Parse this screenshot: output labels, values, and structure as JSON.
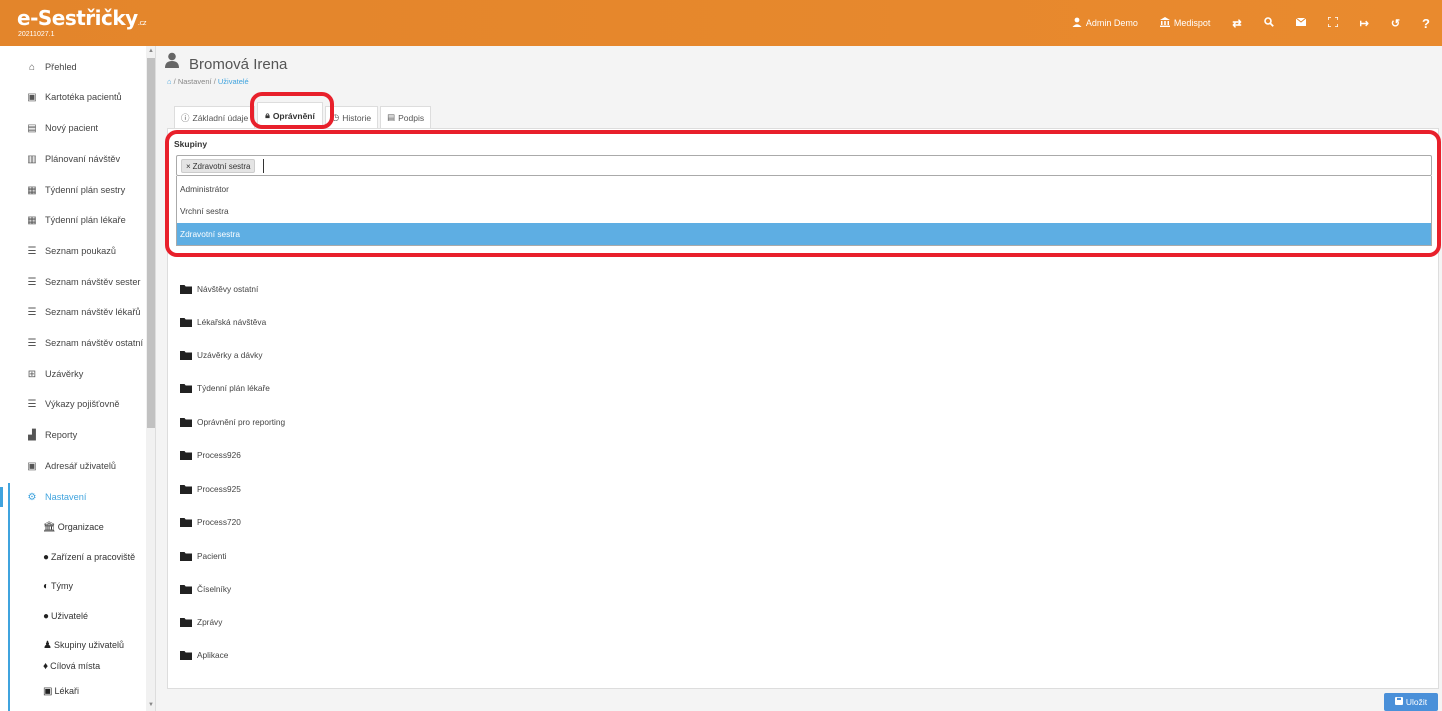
{
  "header": {
    "logo": "e-Sestřičky",
    "logo_suffix": ".cz",
    "version": "20211027.1",
    "nav": [
      {
        "label": "Admin Demo",
        "icon": "user-icon"
      },
      {
        "label": "Medispot",
        "icon": "institution-icon"
      },
      {
        "label": "",
        "icon": "switch-icon"
      },
      {
        "label": "",
        "icon": "search-icon"
      },
      {
        "label": "",
        "icon": "mail-icon"
      },
      {
        "label": "",
        "icon": "fullscreen-icon"
      },
      {
        "label": "",
        "icon": "logout-icon"
      },
      {
        "label": "",
        "icon": "history-icon"
      },
      {
        "label": "",
        "icon": "help-icon"
      }
    ]
  },
  "sidebar": {
    "items": [
      {
        "label": "Přehled",
        "icon": "home-icon"
      },
      {
        "label": "Kartotéka pacientů",
        "icon": "id-card-icon"
      },
      {
        "label": "Nový pacient",
        "icon": "add-card-icon"
      },
      {
        "label": "Plánovaní návštěv",
        "icon": "map-icon"
      },
      {
        "label": "Týdenní plán sestry",
        "icon": "calendar-icon"
      },
      {
        "label": "Týdenní plán lékaře",
        "icon": "calendar-icon"
      },
      {
        "label": "Seznam poukazů",
        "icon": "list-icon"
      },
      {
        "label": "Seznam návštěv sester",
        "icon": "list-icon"
      },
      {
        "label": "Seznam návštěv lékařů",
        "icon": "list-icon"
      },
      {
        "label": "Seznam návštěv ostatní",
        "icon": "list-icon"
      },
      {
        "label": "Uzávěrky",
        "icon": "table-icon"
      },
      {
        "label": "Výkazy pojišťovně",
        "icon": "list-icon"
      },
      {
        "label": "Reporty",
        "icon": "chart-icon"
      },
      {
        "label": "Adresář uživatelů",
        "icon": "address-book-icon"
      },
      {
        "label": "Nastavení",
        "icon": "gears-icon"
      }
    ],
    "subitems": [
      {
        "label": "Organizace",
        "icon": "institution-icon"
      },
      {
        "label": "Zařízení a pracoviště",
        "icon": "hospital-icon"
      },
      {
        "label": "Týmy",
        "icon": "shield-icon"
      },
      {
        "label": "Uživatelé",
        "icon": "user-icon"
      },
      {
        "label": "Skupiny uživatelů",
        "icon": "users-icon"
      },
      {
        "label": "Cílová místa",
        "icon": "map-marker-icon"
      },
      {
        "label": "Lékaři",
        "icon": "doctor-icon"
      }
    ]
  },
  "page": {
    "title": "Bromová Irena",
    "breadcrumb": [
      "Nastavení",
      "Uživatelé"
    ],
    "breadcrumb_sep": "/"
  },
  "tabs": [
    {
      "label": "Základní údaje",
      "icon": "info-icon"
    },
    {
      "label": "Oprávnění",
      "icon": "lock-icon"
    },
    {
      "label": "Historie",
      "icon": "clock-icon"
    },
    {
      "label": "Podpis",
      "icon": "signature-icon"
    }
  ],
  "permissions": {
    "groups_label": "Skupiny",
    "selected_chip": "Zdravotní sestra",
    "chip_remove": "×",
    "options": [
      "Administrátor",
      "Vrchní sestra",
      "Zdravotní sestra"
    ],
    "folders": [
      "Návštěvy ostatní",
      "Lékařská návštěva",
      "Uzávěrky a dávky",
      "Týdenní plán lékaře",
      "Oprávnění pro reporting",
      "Process926",
      "Process925",
      "Process720",
      "Pacienti",
      "Číselníky",
      "Zprávy",
      "Aplikace"
    ]
  },
  "footer": {
    "save_label": "Uložit"
  },
  "colors": {
    "header": "#e3852b",
    "accent": "#3fa3de",
    "highlight": "#e8202b",
    "selected_option": "#5eaee3",
    "save_button": "#4a90d9"
  }
}
